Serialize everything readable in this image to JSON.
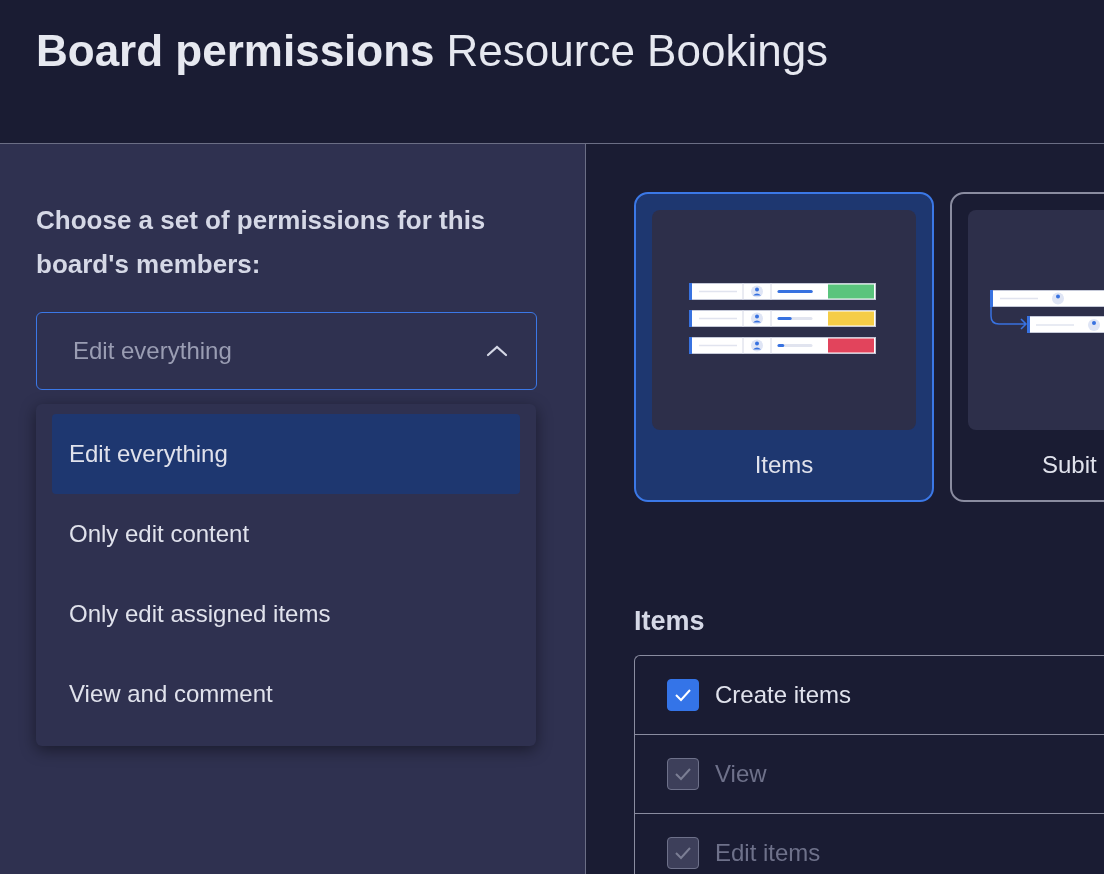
{
  "header": {
    "title": "Board permissions",
    "subtitle": "Resource Bookings"
  },
  "sidebar": {
    "prompt": "Choose a set of permissions for this board's members:",
    "dropdown": {
      "value": "Edit everything",
      "expanded": true,
      "options": [
        {
          "label": "Edit everything",
          "selected": true
        },
        {
          "label": "Only edit content",
          "selected": false
        },
        {
          "label": "Only edit assigned items",
          "selected": false
        },
        {
          "label": "View and comment",
          "selected": false
        }
      ]
    }
  },
  "views": [
    {
      "label": "Items",
      "selected": true,
      "kind": "items"
    },
    {
      "label": "Subit",
      "selected": false,
      "kind": "subitems"
    }
  ],
  "section": {
    "title": "Items",
    "permissions": [
      {
        "label": "Create items",
        "checked": true,
        "disabled": false
      },
      {
        "label": "View",
        "checked": true,
        "disabled": true
      },
      {
        "label": "Edit items",
        "checked": true,
        "disabled": true
      }
    ]
  }
}
